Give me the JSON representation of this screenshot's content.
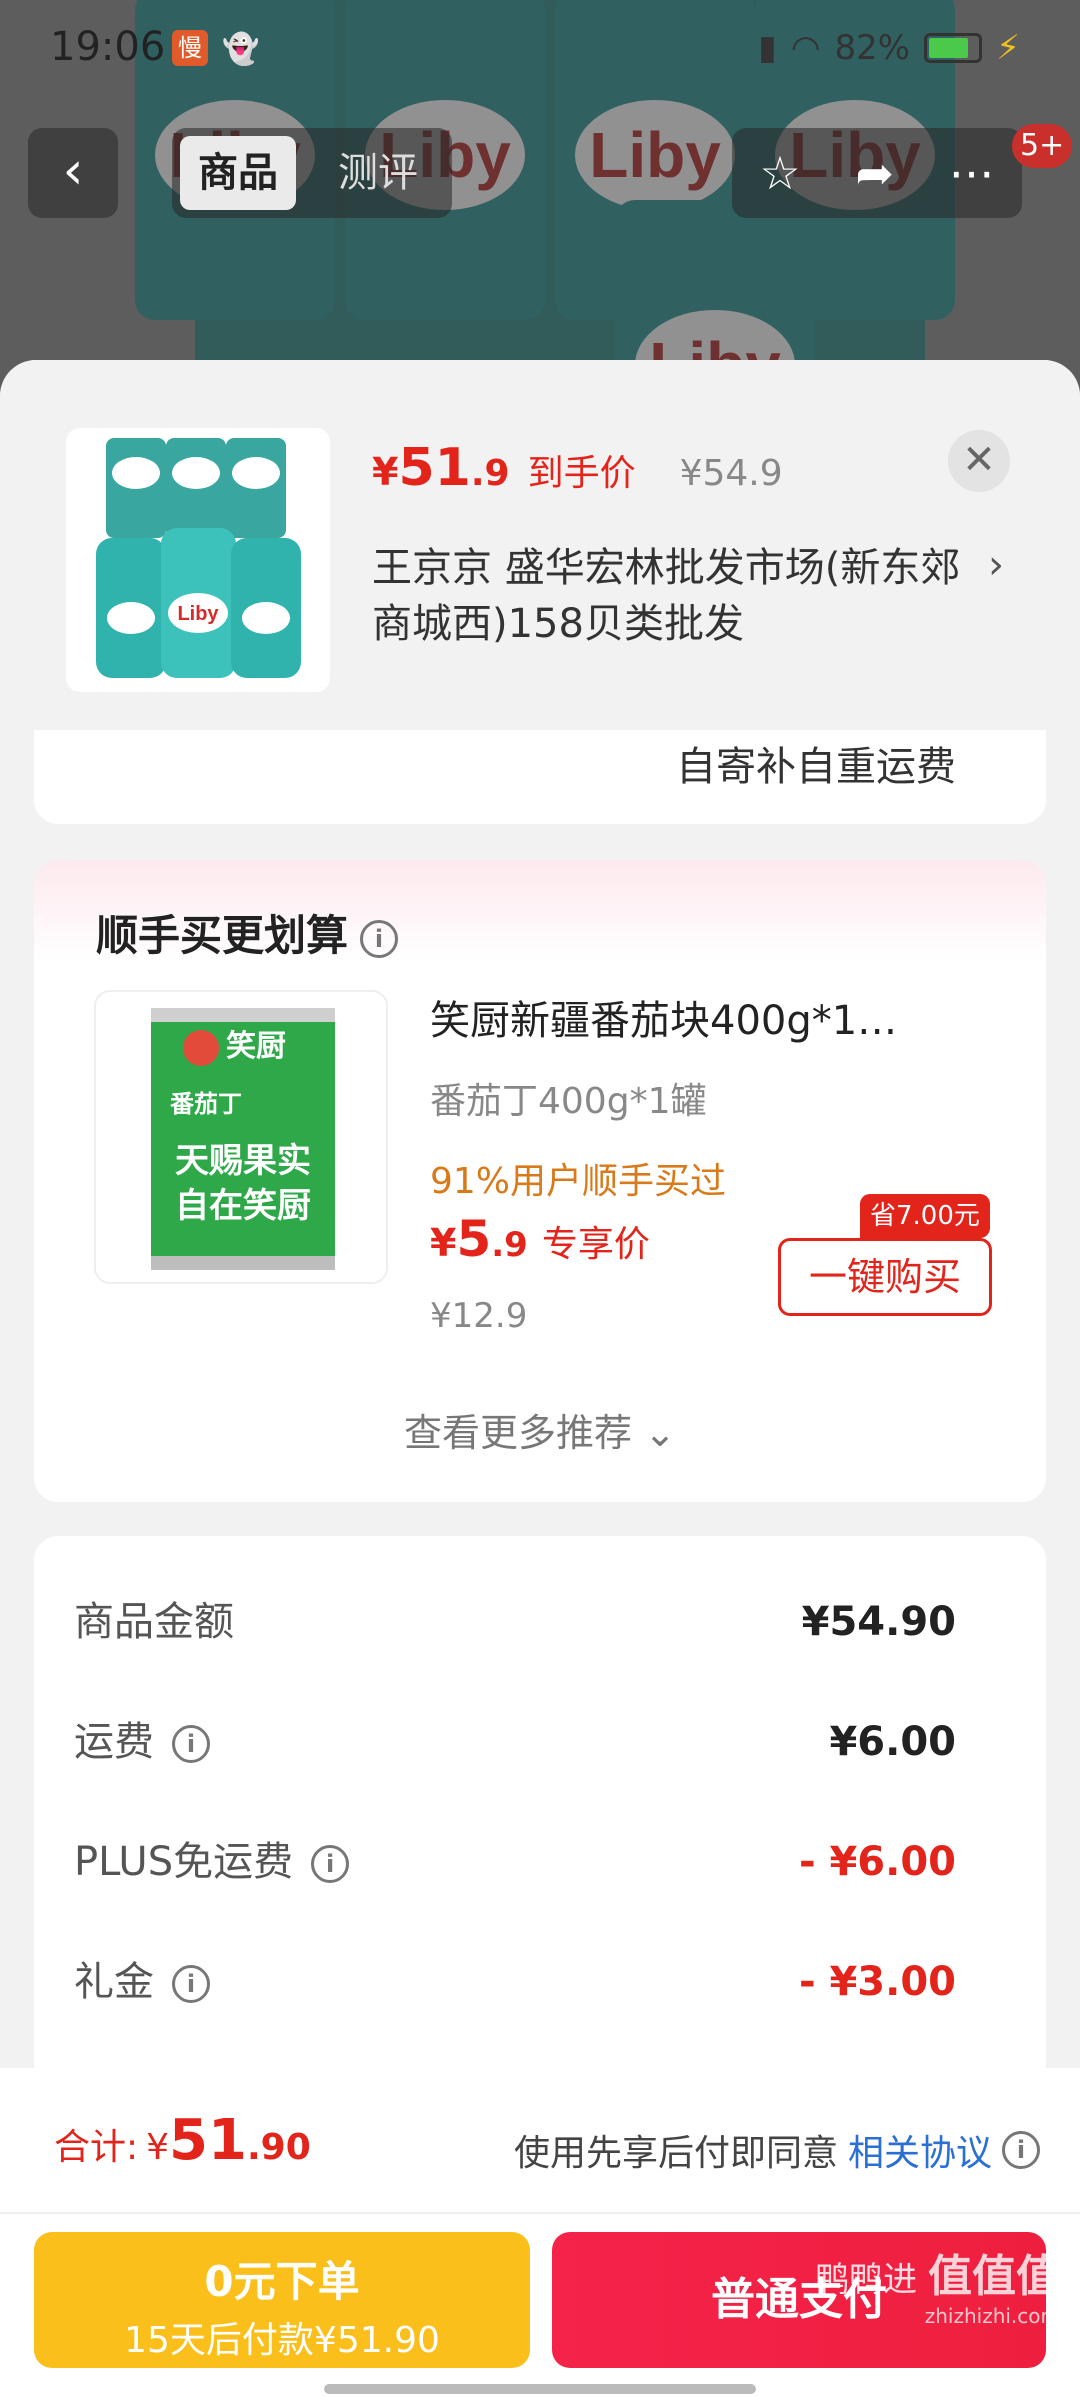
{
  "status_bar": {
    "time": "19:06",
    "app_icon_text": "慢",
    "battery": "82%",
    "battery_level": 0.82
  },
  "nav": {
    "back_icon": "chevron-left-icon",
    "tabs": [
      {
        "label": "商品",
        "active": true
      },
      {
        "label": "测评",
        "active": false
      }
    ],
    "notif_badge": "5+"
  },
  "background_product": {
    "brand": "Liby"
  },
  "sheet": {
    "product": {
      "price_symbol": "¥",
      "price_int": "51",
      "price_dec": ".9",
      "price_label": "到手价",
      "original_price": "¥54.9",
      "shop": "王京京  盛华宏林批发市场(新东郊商城西)158贝类批发"
    },
    "shipping_note": "自寄补自重运费",
    "recommend": {
      "title": "顺手买更划算",
      "item": {
        "name": "笑厨新疆番茄块400g*1…",
        "spec": "番茄丁400g*1罐",
        "bought": "91%用户顺手买过",
        "price_symbol": "¥",
        "price_int": "5",
        "price_dec": ".9",
        "price_label": "专享价",
        "original_price": "¥12.9",
        "save_tag": "省7.00元",
        "buy_label": "一键购买",
        "can_brand": "笑厨",
        "can_text_1": "番茄丁",
        "can_text_2": "天赐果实",
        "can_text_3": "自在笑厨"
      },
      "more_label": "查看更多推荐",
      "more_icon": "chevron-down-icon"
    },
    "summary": [
      {
        "label": "商品金额",
        "value": "¥54.90",
        "info": false,
        "discount": false
      },
      {
        "label": "运费",
        "value": "¥6.00",
        "info": true,
        "discount": false
      },
      {
        "label": "PLUS免运费",
        "value": "- ¥6.00",
        "info": true,
        "discount": true
      },
      {
        "label": "礼金",
        "value": "- ¥3.00",
        "info": true,
        "discount": true
      }
    ]
  },
  "bottom": {
    "total_label": "合计:",
    "total_symbol": "¥",
    "total_int": "51",
    "total_dec": ".90",
    "agree_text": "使用先享后付即同意",
    "agree_link": "相关协议",
    "pay_later_line1": "0元下单",
    "pay_later_line2": "15天后付款¥51.90",
    "pay_normal": "普通支付",
    "watermark_text": "鸭鸭进",
    "watermark_logo": "值值值",
    "watermark_url": "zhizhizhi.com"
  },
  "colors": {
    "accent_red": "#e3241b",
    "pay_later_yellow": "#fbbf1b",
    "pay_normal_red": "#f5224a",
    "link_blue": "#2b6fd4",
    "bought_orange": "#d87a1a"
  }
}
